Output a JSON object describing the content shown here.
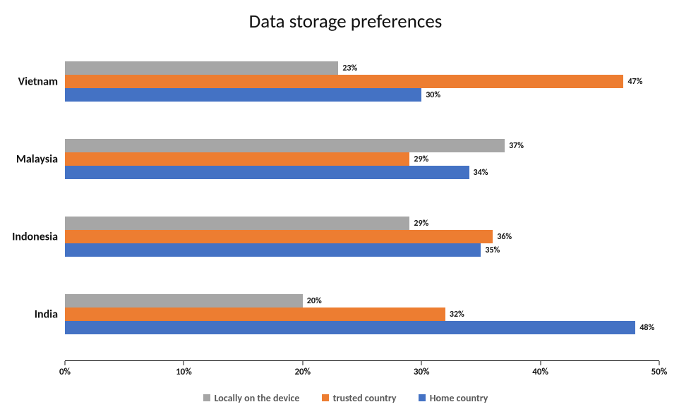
{
  "chart_data": {
    "type": "bar",
    "orientation": "horizontal",
    "title": "Data storage preferences",
    "xlabel": "",
    "ylabel": "",
    "xlim": [
      0,
      50
    ],
    "x_ticks": [
      0,
      10,
      20,
      30,
      40,
      50
    ],
    "x_tick_labels": [
      "0%",
      "10%",
      "20%",
      "30%",
      "40%",
      "50%"
    ],
    "categories": [
      "Vietnam",
      "Malaysia",
      "Indonesia",
      "India"
    ],
    "series": [
      {
        "name": "Locally on the device",
        "color": "#a6a6a6",
        "values": [
          23,
          37,
          29,
          20
        ],
        "labels": [
          "23%",
          "37%",
          "29%",
          "20%"
        ]
      },
      {
        "name": "trusted country",
        "color": "#ed7d31",
        "values": [
          47,
          29,
          36,
          32
        ],
        "labels": [
          "47%",
          "29%",
          "36%",
          "32%"
        ]
      },
      {
        "name": "Home country",
        "color": "#4472c4",
        "values": [
          30,
          34,
          35,
          48
        ],
        "labels": [
          "30%",
          "34%",
          "35%",
          "48%"
        ]
      }
    ],
    "legend_position": "bottom"
  }
}
